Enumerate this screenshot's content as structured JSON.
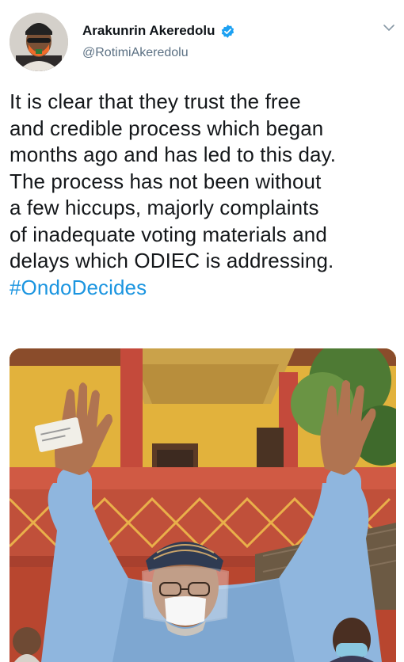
{
  "tweet": {
    "display_name": "Arakunrin Akeredolu",
    "handle": "@RotimiAkeredolu",
    "text_lines": [
      "It is clear that they trust the free",
      "and credible process which began",
      "months ago and has led to this day.",
      "The process has not been without",
      "a few hiccups, majorly complaints",
      "of inadequate voting materials and",
      "delays which ODIEC is addressing."
    ],
    "hashtag": "#OndoDecides"
  },
  "icons": {
    "verified": "verified-badge-icon",
    "menu": "chevron-down-icon"
  },
  "colors": {
    "verified_blue": "#1da1f2",
    "hashtag_blue": "#1b95e0",
    "handle_gray": "#5b7083",
    "text": "#14171a"
  }
}
